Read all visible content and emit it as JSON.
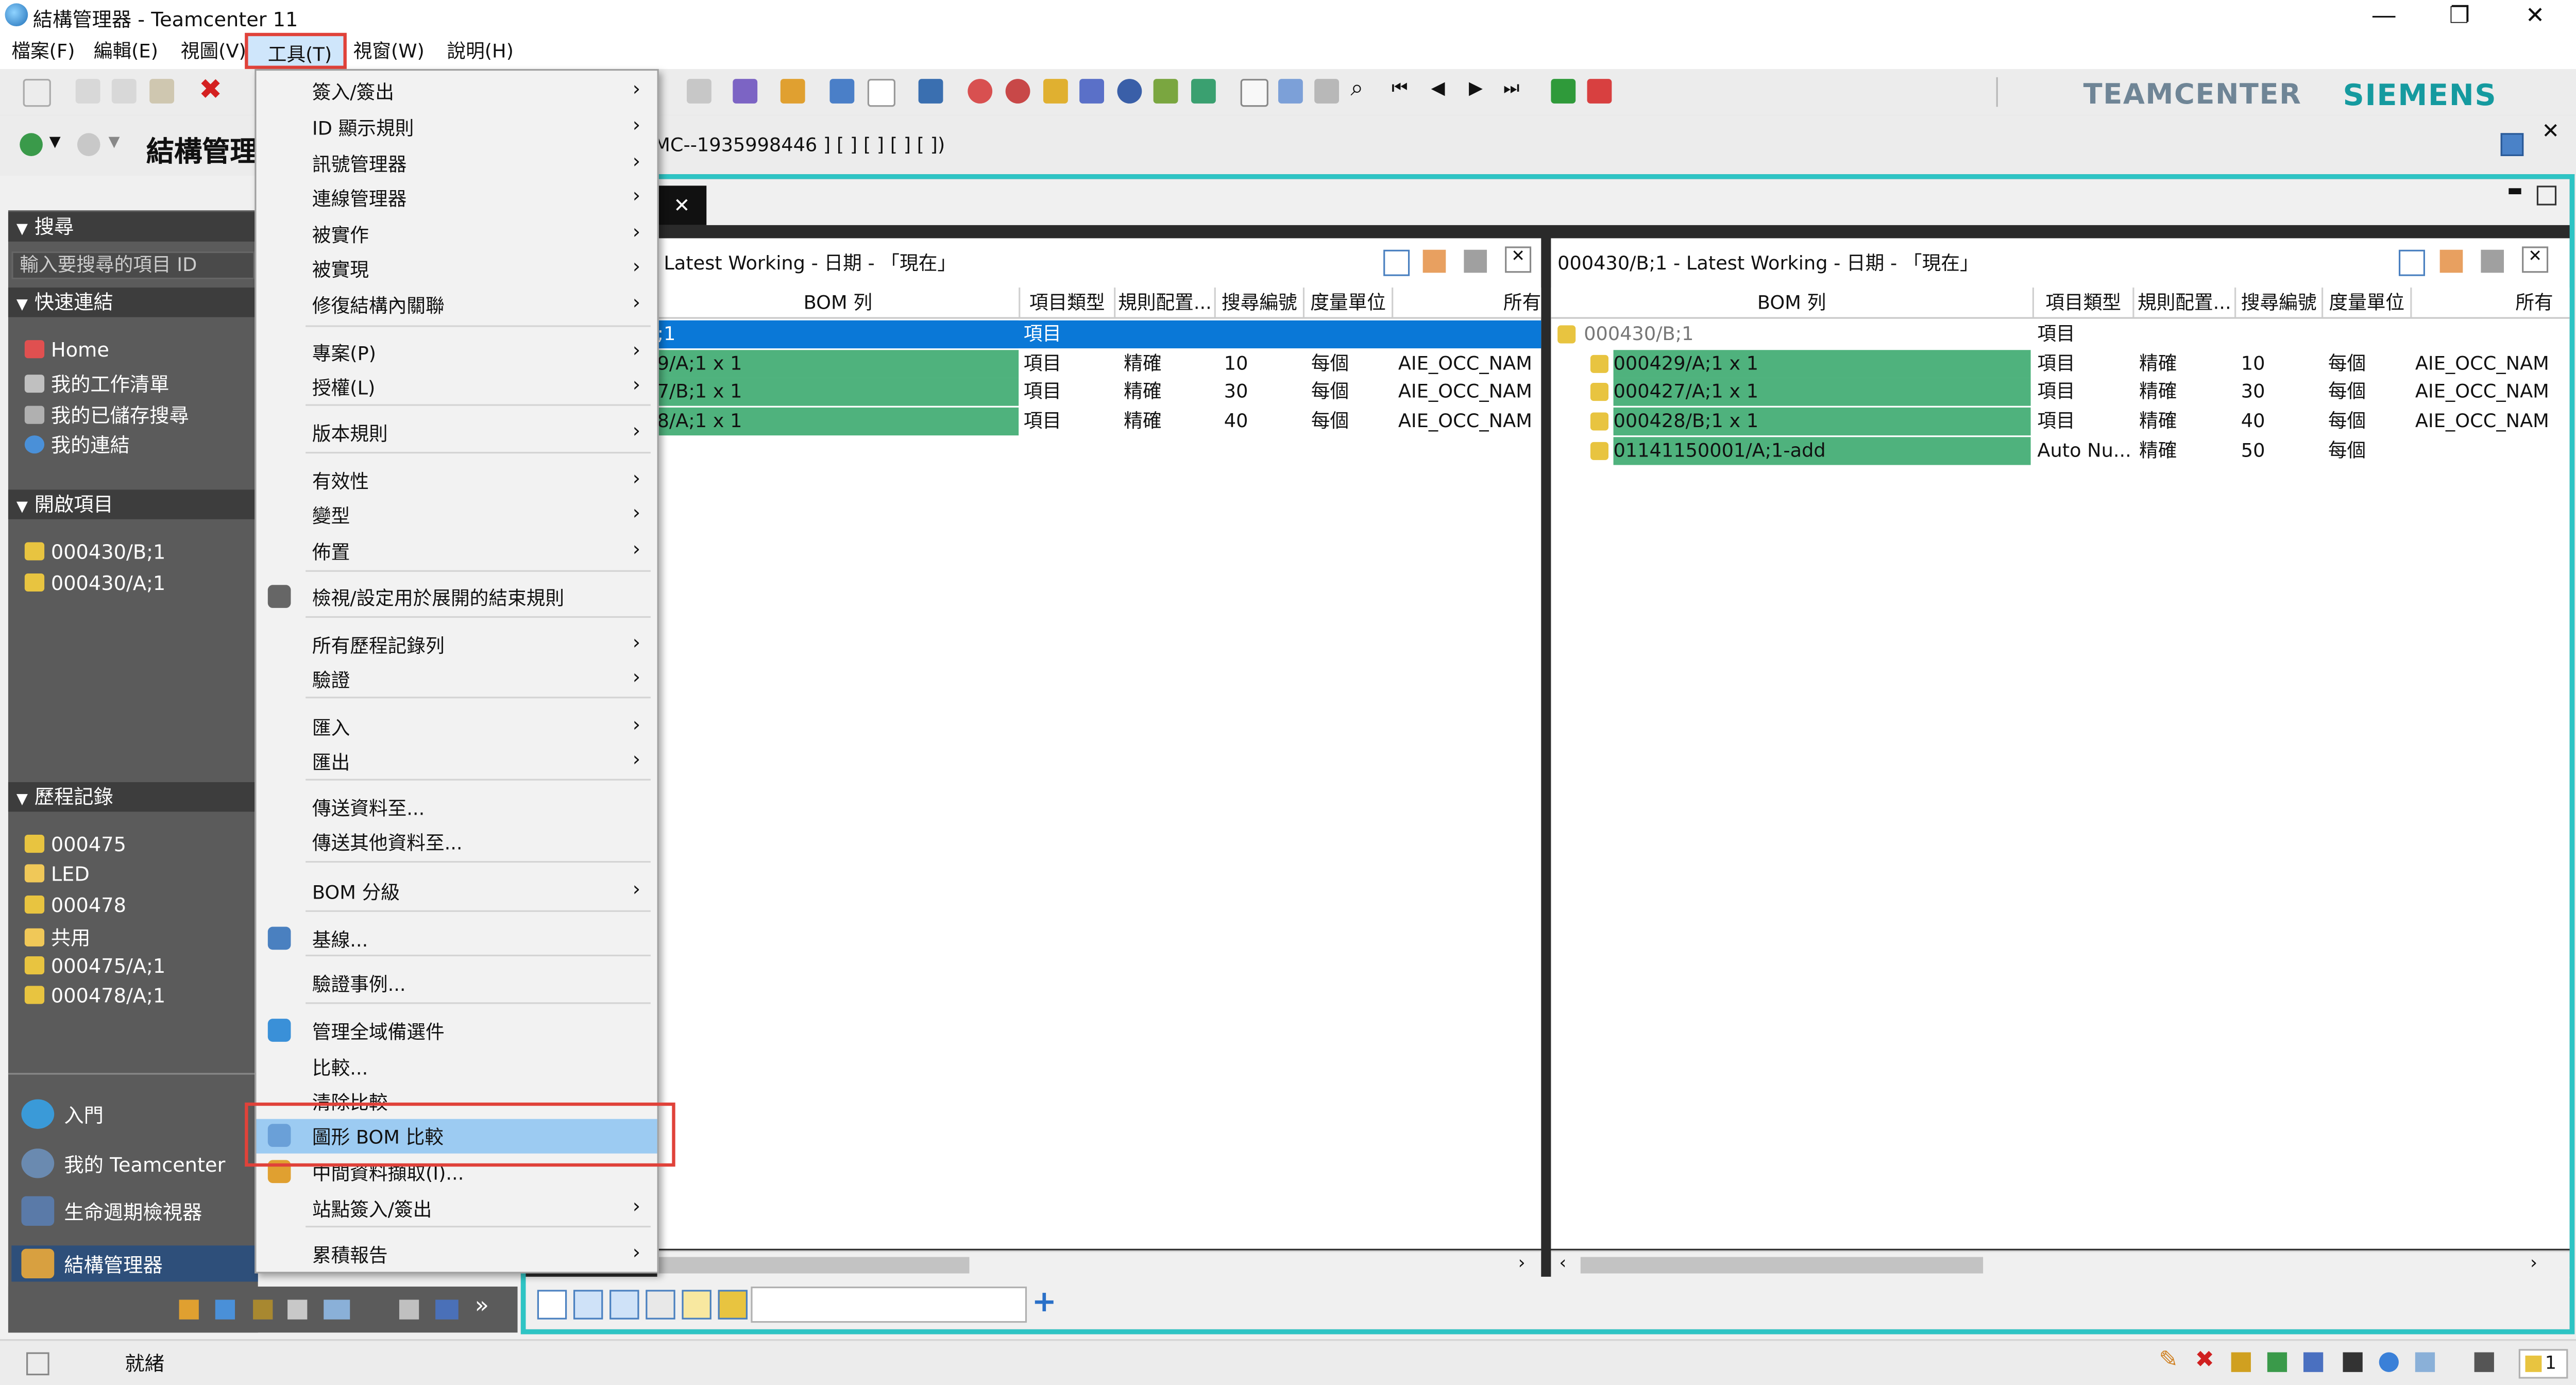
{
  "window": {
    "title": "結構管理器 - Teamcenter 11"
  },
  "menubar": [
    "檔案(F)",
    "編輯(E)",
    "視圖(V)",
    "工具(T)",
    "視窗(W)",
    "說明(H)"
  ],
  "brand": {
    "teamcenter": "TEAMCENTER",
    "siemens": "SIEMENS"
  },
  "app": {
    "title": "結構管理",
    "breadcrumb": "MC--1935998446 ] [ ] [ ] [ ] [ ])"
  },
  "left": {
    "search_header": "搜尋",
    "search_placeholder": "輸入要搜尋的項目 ID",
    "quick_header": "快速連結",
    "quick_links": [
      "Home",
      "我的工作清單",
      "我的已儲存搜尋",
      "我的連結"
    ],
    "open_header": "開啟項目",
    "open_items": [
      "000430/B;1",
      "000430/A;1"
    ],
    "history_header": "歷程記錄",
    "history_items": [
      "000475",
      "LED",
      "000478",
      "共用",
      "000475/A;1",
      "000478/A;1"
    ],
    "nav": [
      "入門",
      "我的 Teamcenter",
      "生命週期檢視器",
      "結構管理器"
    ]
  },
  "left_pane": {
    "header": "Latest Working - 日期 - 「現在」",
    "columns": [
      "BOM 列",
      "項目類型",
      "規則配置...",
      "搜尋編號",
      "度量單位",
      "所有"
    ],
    "rows": [
      {
        "bom": ";1",
        "type": "項目",
        "rule": "",
        "find": "",
        "uom": "",
        "owner": ""
      },
      {
        "bom": "9/A;1 x 1",
        "type": "項目",
        "rule": "精確",
        "find": "10",
        "uom": "每個",
        "owner": "AIE_OCC_NAM"
      },
      {
        "bom": "7/B;1 x 1",
        "type": "項目",
        "rule": "精確",
        "find": "30",
        "uom": "每個",
        "owner": "AIE_OCC_NAM"
      },
      {
        "bom": "8/A;1 x 1",
        "type": "項目",
        "rule": "精確",
        "find": "40",
        "uom": "每個",
        "owner": "AIE_OCC_NAM"
      }
    ]
  },
  "right_pane": {
    "header": "000430/B;1 - Latest Working - 日期 - 「現在」",
    "columns": [
      "BOM 列",
      "項目類型",
      "規則配置...",
      "搜尋編號",
      "度量單位",
      "所有"
    ],
    "rows": [
      {
        "bom": "000430/B;1",
        "type": "項目",
        "rule": "",
        "find": "",
        "uom": "",
        "owner": ""
      },
      {
        "bom": "000429/A;1 x 1",
        "type": "項目",
        "rule": "精確",
        "find": "10",
        "uom": "每個",
        "owner": "AIE_OCC_NAM"
      },
      {
        "bom": "000427/A;1 x 1",
        "type": "項目",
        "rule": "精確",
        "find": "30",
        "uom": "每個",
        "owner": "AIE_OCC_NAM"
      },
      {
        "bom": "000428/B;1 x 1",
        "type": "項目",
        "rule": "精確",
        "find": "40",
        "uom": "每個",
        "owner": "AIE_OCC_NAM"
      },
      {
        "bom": "01141150001/A;1-add",
        "type": "Auto Nu...",
        "rule": "精確",
        "find": "50",
        "uom": "每個",
        "owner": ""
      }
    ]
  },
  "tools_menu": [
    {
      "label": "簽入/簽出",
      "arrow": true
    },
    {
      "label": "ID 顯示規則",
      "arrow": true
    },
    {
      "label": "訊號管理器",
      "arrow": true
    },
    {
      "label": "連線管理器",
      "arrow": true
    },
    {
      "label": "被實作",
      "arrow": true
    },
    {
      "label": "被實現",
      "arrow": true
    },
    {
      "label": "修復結構內關聯",
      "arrow": true
    },
    {
      "label": "專案(P)",
      "arrow": true
    },
    {
      "label": "授權(L)",
      "arrow": true
    },
    {
      "label": "版本規則",
      "arrow": true
    },
    {
      "label": "有效性",
      "arrow": true
    },
    {
      "label": "變型",
      "arrow": true
    },
    {
      "label": "佈置",
      "arrow": true
    },
    {
      "label": "檢視/設定用於展開的結束規則",
      "arrow": false
    },
    {
      "label": "所有歷程記錄列",
      "arrow": true
    },
    {
      "label": "驗證",
      "arrow": true
    },
    {
      "label": "匯入",
      "arrow": true
    },
    {
      "label": "匯出",
      "arrow": true
    },
    {
      "label": "傳送資料至...",
      "arrow": false
    },
    {
      "label": "傳送其他資料至...",
      "arrow": false
    },
    {
      "label": "BOM 分級",
      "arrow": true
    },
    {
      "label": "基線...",
      "arrow": false
    },
    {
      "label": "驗證事例...",
      "arrow": false
    },
    {
      "label": "管理全域備選件",
      "arrow": false
    },
    {
      "label": "比較...",
      "arrow": false
    },
    {
      "label": "清除比較",
      "arrow": false
    },
    {
      "label": "圖形 BOM 比較",
      "arrow": false
    },
    {
      "label": "中間資料擷取(I)...",
      "arrow": false
    },
    {
      "label": "站點簽入/簽出",
      "arrow": true
    },
    {
      "label": "累積報告",
      "arrow": true
    }
  ],
  "status": {
    "text": "就緒",
    "count": "1"
  }
}
